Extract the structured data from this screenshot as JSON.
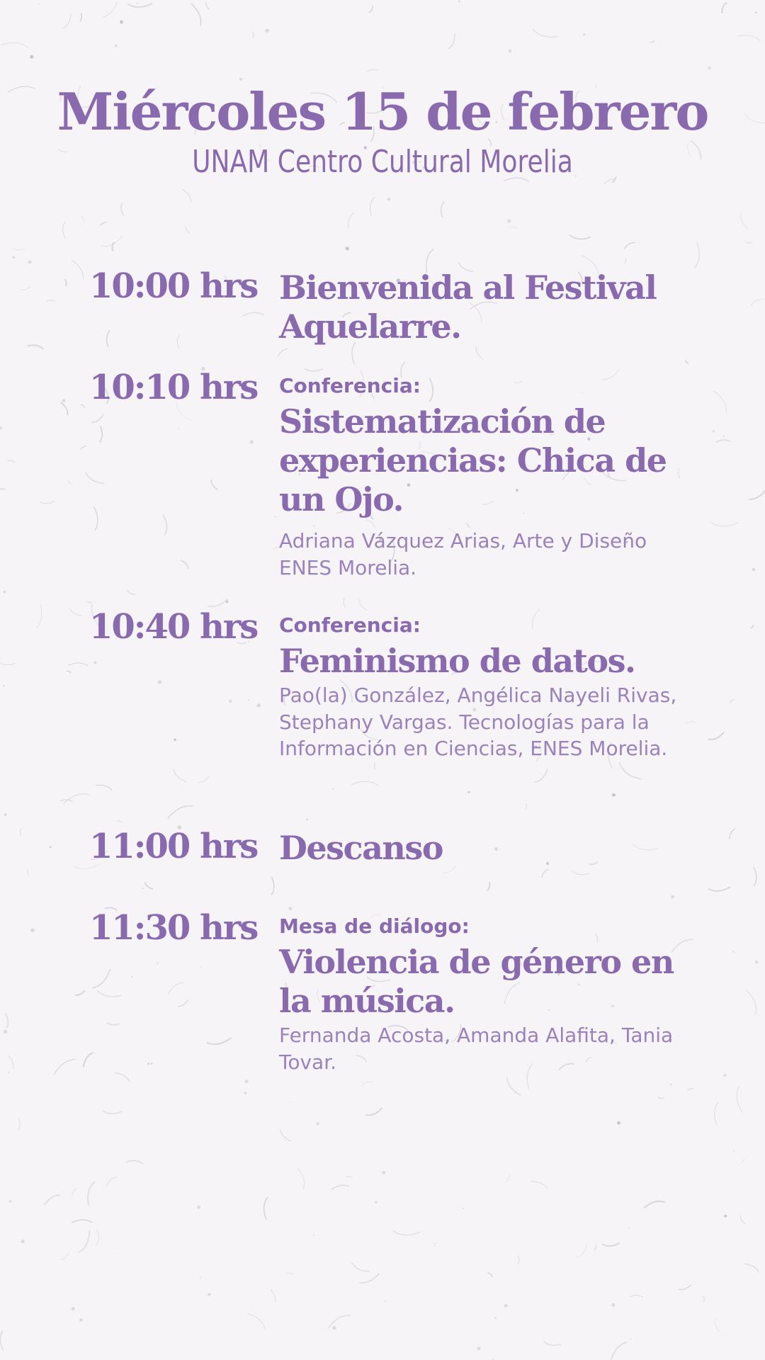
{
  "header": {
    "title": "Miércoles 15 de febrero",
    "subtitle": "UNAM Centro Cultural Morelia"
  },
  "colors": {
    "accent": "#8a6aaf",
    "text_light": "#9b82bb",
    "background": "#f6f4f7"
  },
  "schedule": [
    {
      "time": "10:00 hrs",
      "label": "",
      "title": "Bienvenida al Festival Aquelarre.",
      "speakers": ""
    },
    {
      "time": "10:10 hrs",
      "label": "Conferencia:",
      "title": "Sistematización de experiencias: Chica de un Ojo.",
      "speakers": "Adriana Vázquez Arias, Arte y Diseño ENES Morelia."
    },
    {
      "time": "10:40 hrs",
      "label": "Conferencia:",
      "title": "Feminismo de datos.",
      "speakers": "Pao(la) González, Angélica Nayeli Rivas, Stephany Vargas. Tecnologías para la Información en Ciencias, ENES Morelia."
    },
    {
      "time": "11:00 hrs",
      "label": "",
      "title": "Descanso",
      "speakers": ""
    },
    {
      "time": "11:30 hrs",
      "label": "Mesa de diálogo:",
      "title": "Violencia de género en la música.",
      "speakers": "Fernanda Acosta, Amanda Alafita, Tania Tovar."
    }
  ]
}
